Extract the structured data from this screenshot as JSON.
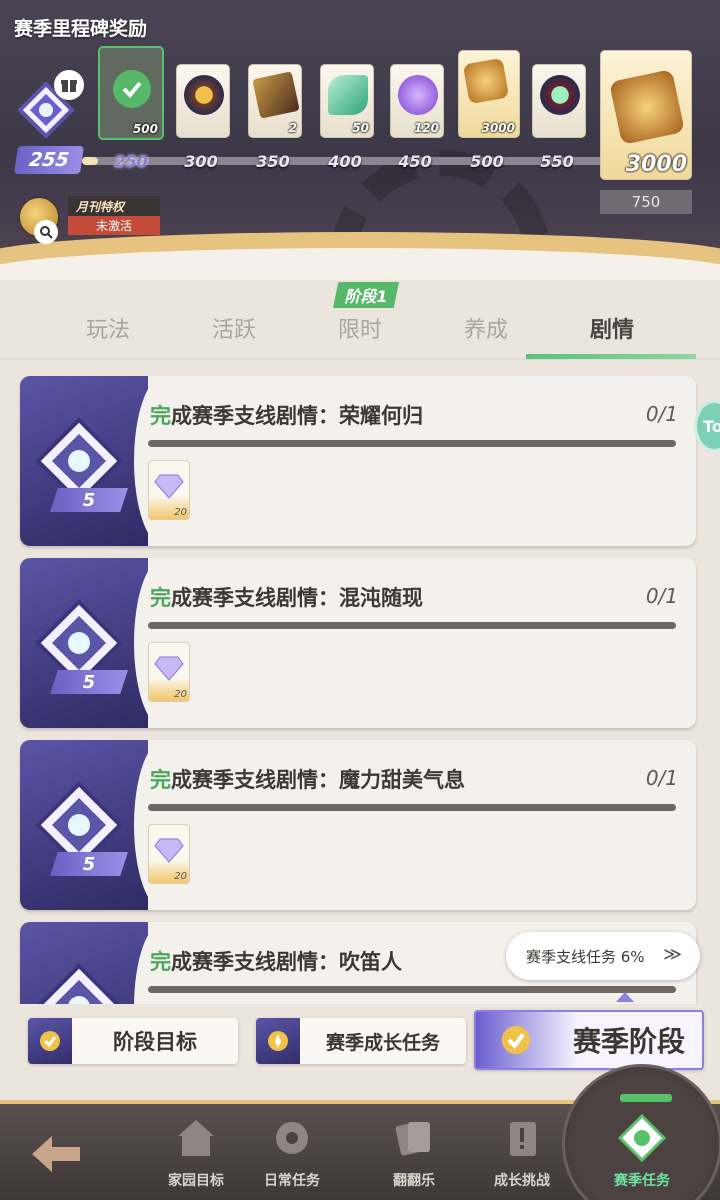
{
  "header": {
    "title": "赛季里程碑奖励",
    "total_points": "255",
    "big_reward_qty": "3000",
    "big_reward_threshold": "750",
    "progress_fraction": 0.03
  },
  "milestones": [
    {
      "threshold": "250",
      "qty": "500",
      "claimed": true
    },
    {
      "threshold": "300",
      "qty": ""
    },
    {
      "threshold": "350",
      "qty": "2"
    },
    {
      "threshold": "400",
      "qty": "50"
    },
    {
      "threshold": "450",
      "qty": "120"
    },
    {
      "threshold": "500",
      "qty": "3000"
    },
    {
      "threshold": "550",
      "qty": ""
    }
  ],
  "monthly": {
    "name": "月刊特权",
    "status": "未激活"
  },
  "phase_tag": "阶段1",
  "tabs": [
    "玩法",
    "活跃",
    "限时",
    "养成",
    "剧情"
  ],
  "active_tab": 4,
  "tasks": [
    {
      "prefix": "完",
      "title": "成赛季支线剧情：荣耀何归",
      "progress": "0/1",
      "points": "5",
      "reward_qty": "20"
    },
    {
      "prefix": "完",
      "title": "成赛季支线剧情：混沌随现",
      "progress": "0/1",
      "points": "5",
      "reward_qty": "20"
    },
    {
      "prefix": "完",
      "title": "成赛季支线剧情：魔力甜美气息",
      "progress": "0/1",
      "points": "5",
      "reward_qty": "20"
    },
    {
      "prefix": "完",
      "title": "成赛季支线剧情：吹笛人",
      "progress": "",
      "points": "",
      "reward_qty": ""
    }
  ],
  "bubble": {
    "text": "赛季支线任务 6%",
    "chevron": "≫"
  },
  "side_badge": "To",
  "subtabs": [
    "阶段目标",
    "赛季成长任务",
    "赛季阶段"
  ],
  "nav": [
    "家园目标",
    "日常任务",
    "翻翻乐",
    "成长挑战",
    "赛季任务"
  ],
  "colors": {
    "accent_purple": "#6b5fd0",
    "accent_green": "#58c26b",
    "gold": "#e6c37e"
  },
  "icons": {
    "gift": "gift-icon",
    "check": "check-icon",
    "magnifier": "magnifier-icon",
    "emblem": "season-emblem-icon",
    "gem": "crystal-icon",
    "back": "back-arrow-icon"
  }
}
